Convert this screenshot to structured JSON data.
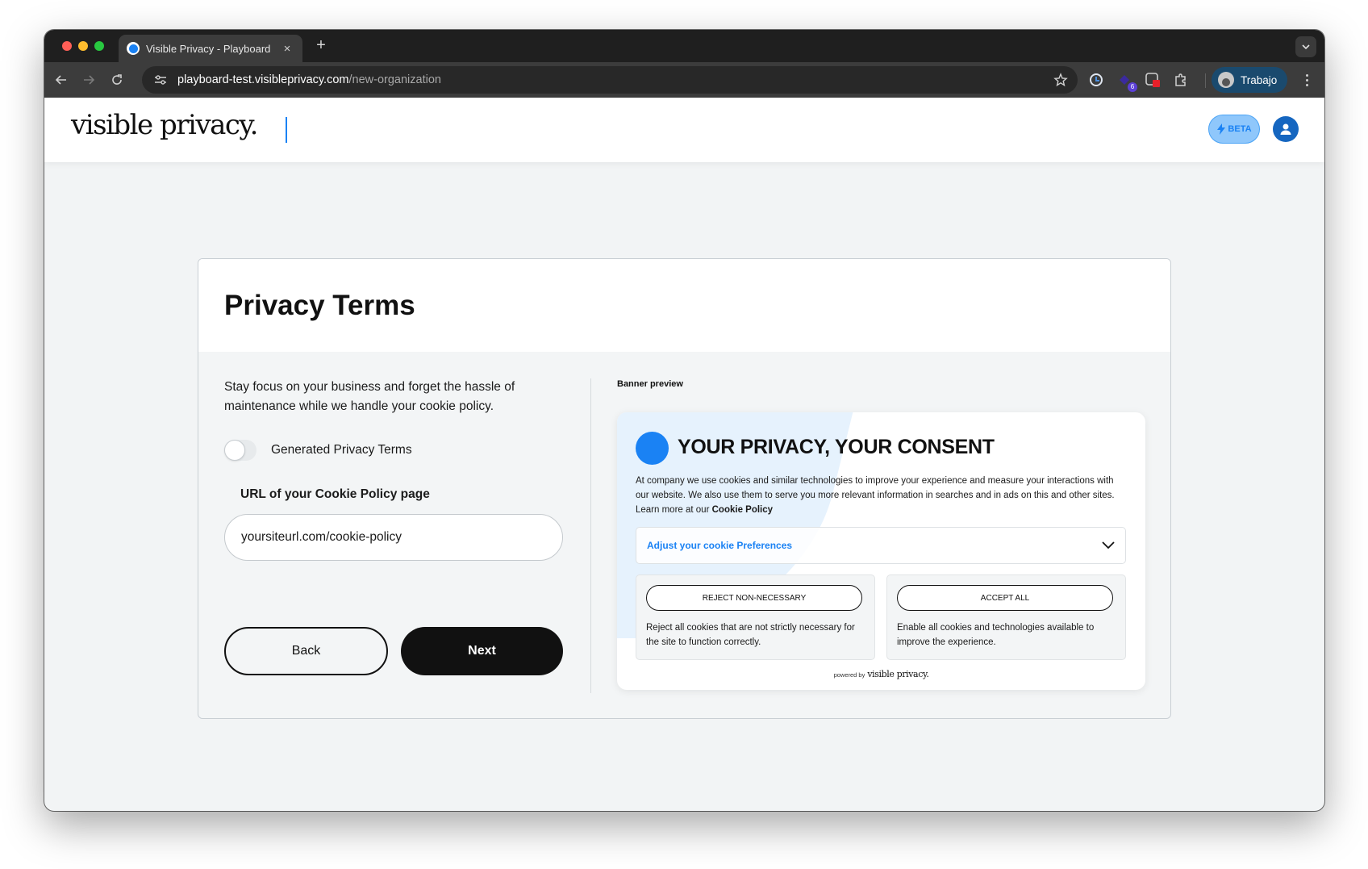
{
  "browser": {
    "tab_title": "Visible Privacy - Playboard",
    "tab_close": "×",
    "new_tab": "+",
    "url_host": "playboard-test.visibleprivacy.com",
    "url_path": "/new-organization",
    "extension_badge": "6",
    "profile_name": "Trabajo"
  },
  "header": {
    "logo_text": "visible privacy.",
    "beta_label": "BETA"
  },
  "page": {
    "title": "Privacy Terms",
    "intro": "Stay focus on your business and forget the hassle of maintenance while we handle your cookie policy.",
    "toggle_label": "Generated Privacy Terms",
    "toggle_on": false,
    "url_label": "URL of your Cookie Policy page",
    "url_value": "yoursiteurl.com/cookie-policy",
    "back_label": "Back",
    "next_label": "Next"
  },
  "preview": {
    "label": "Banner preview",
    "title": "YOUR PRIVACY, YOUR CONSENT",
    "text": "At company we use cookies and similar technologies to improve your experience and measure your interactions with our website. We also use them to serve you more relevant information in searches and in ads on this and other sites. Learn more at our",
    "policy_link": "Cookie Policy",
    "preferences_label": "Adjust your cookie Preferences",
    "reject_label": "REJECT NON-NECESSARY",
    "reject_desc": "Reject all cookies that are not strictly necessary for the site to function correctly.",
    "accept_label": "ACCEPT ALL",
    "accept_desc": "Enable all cookies and technologies available to improve the experience.",
    "powered_by": "powered by",
    "powered_logo": "visible privacy."
  },
  "colors": {
    "accent": "#1a82f4",
    "primary_button": "#111111",
    "page_background": "#f2f4f5"
  }
}
